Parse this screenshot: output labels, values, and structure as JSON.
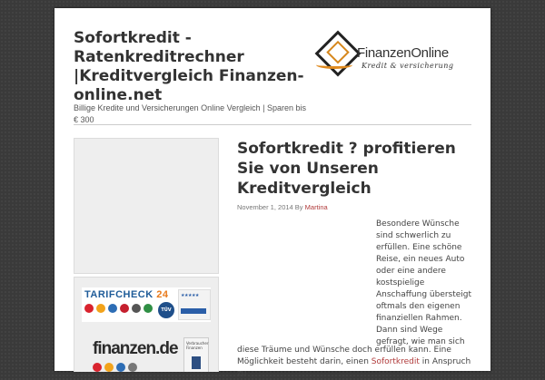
{
  "header": {
    "site_title": "Sofortkredit - Ratenkreditrechner |Kreditvergleich Finanzen-online.net",
    "site_description": "Billige Kredite und Versicherungen Online Vergleich | Sparen bis € 300",
    "logo": {
      "name_part1": "Finanzen",
      "name_part2": "Online",
      "tagline": "Kredit & versicherung",
      "accent_color": "#e08a1e"
    }
  },
  "sidebar": {
    "ads": {
      "tarifcheck": {
        "label_part1": "TARIFCHECK",
        "label_part2": "24",
        "tuv_text": "TÜV",
        "award_text": "★★★★★"
      },
      "finanzen_de": {
        "logo_text": "finanzen.de",
        "badge_text": "Verbraucher Finanzen"
      }
    }
  },
  "post": {
    "title": "Sofortkredit ? profitieren Sie von Unseren Kreditvergleich",
    "date": "November 1, 2014",
    "by_label": "By",
    "author": "Martina",
    "paragraph_wrapped": "Besondere Wünsche sind schwerlich zu erfüllen. Eine schöne Reise, ein neues Auto oder eine andere kostspielige Anschaffung übersteigt oftmals den eigenen finanziellen Rahmen. Dann sind Wege gefragt, wie man sich",
    "paragraph_full_line1": "diese Träume und Wünsche doch erfüllen kann. Eine",
    "paragraph_full_line2_pre": "Möglichkeit besteht darin, einen",
    "paragraph_full_link": "Sofortkredit",
    "paragraph_full_line2_post": "in Anspruch zu"
  }
}
